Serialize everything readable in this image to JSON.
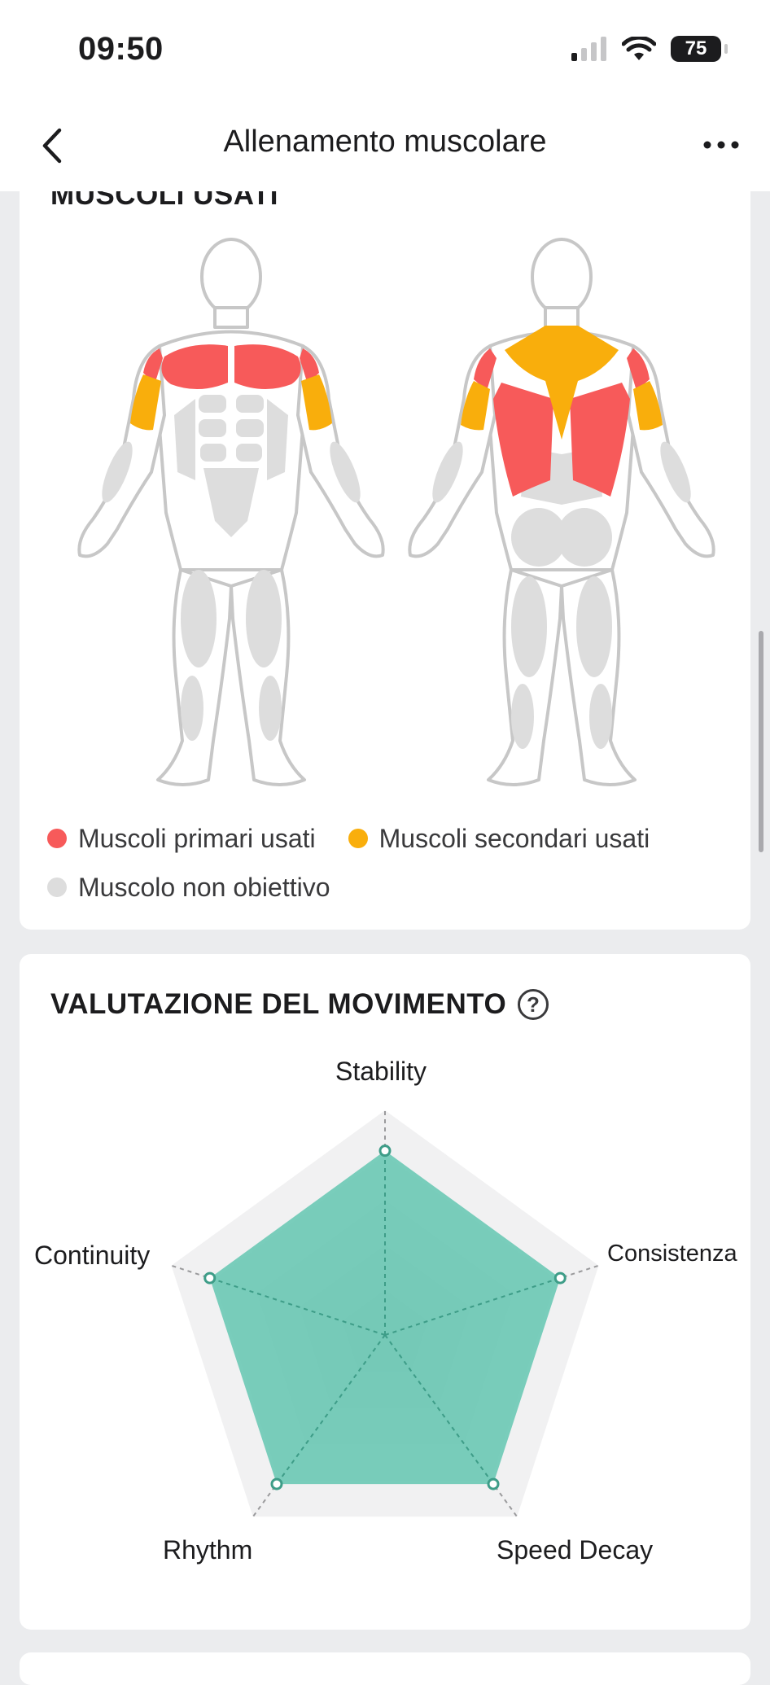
{
  "status": {
    "time": "09:50",
    "battery": "75",
    "icons": [
      "signal-icon",
      "wifi-icon",
      "battery-icon"
    ]
  },
  "nav": {
    "title": "Allenamento muscolare",
    "back_icon": "chevron-left-icon",
    "more_icon": "more-horizontal-icon"
  },
  "muscles": {
    "heading": "MUSCOLI USATI",
    "figures": [
      "front-body",
      "back-body"
    ],
    "legend": {
      "primary": "Muscoli primari usati",
      "secondary": "Muscoli secondari usati",
      "non_target": "Muscolo non obiettivo"
    },
    "colors": {
      "primary": "#f75a5a",
      "secondary": "#f9ae0c",
      "non_target": "#dddddd",
      "outline": "#c7c7c7"
    }
  },
  "evaluation": {
    "heading": "VALUTAZIONE DEL MOVIMENTO",
    "help_icon": "question-circle-icon",
    "chart_data": {
      "type": "radar",
      "axes": [
        "Stability",
        "Consistenza",
        "Speed Decay",
        "Rhythm",
        "Continuity"
      ],
      "values": [
        0.82,
        0.82,
        0.82,
        0.82,
        0.82
      ],
      "range": [
        0,
        1
      ],
      "fill_color": "#5ec4ae",
      "grid": true
    }
  }
}
